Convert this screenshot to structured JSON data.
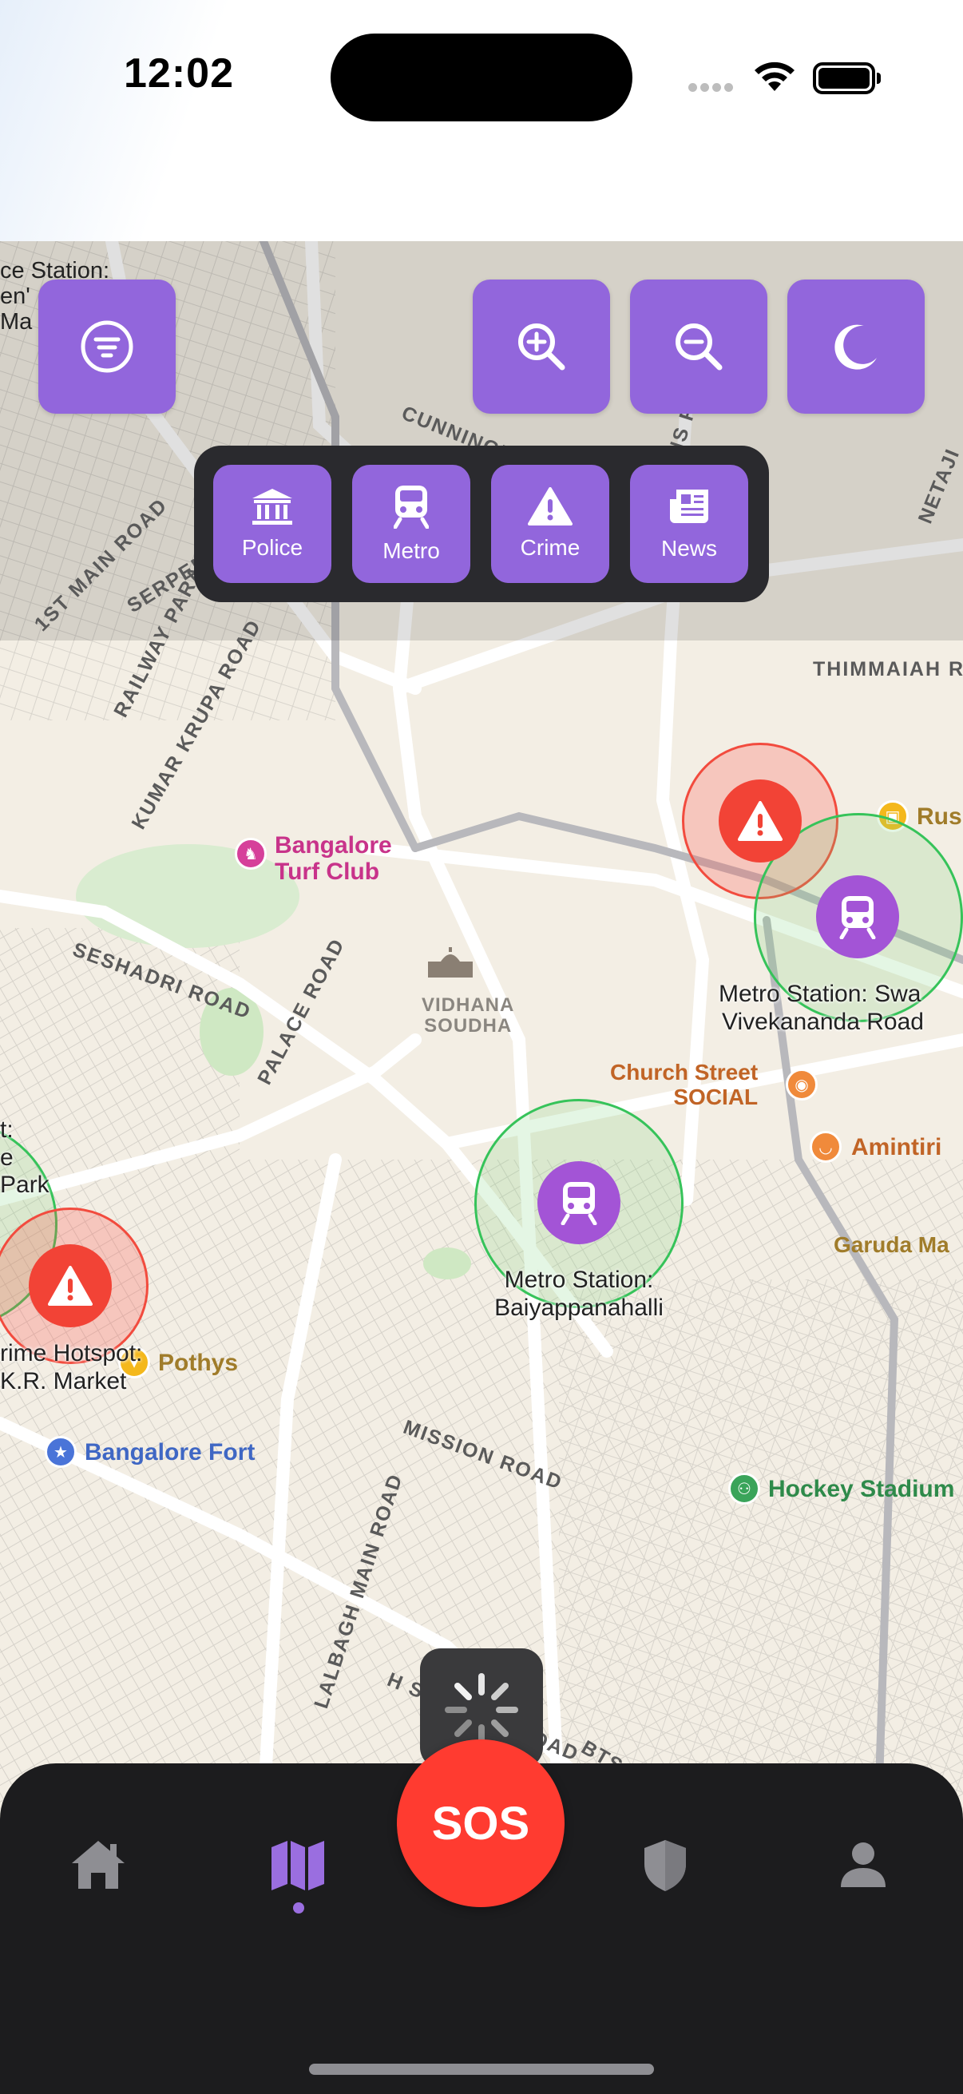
{
  "status_bar": {
    "time": "12:02"
  },
  "controls": {
    "filter_icon": "filter-icon",
    "zoom_in_icon": "zoom-in-icon",
    "zoom_out_icon": "zoom-out-icon",
    "theme_icon": "moon-icon"
  },
  "layers": [
    {
      "label": "Police",
      "icon": "bank-icon"
    },
    {
      "label": "Metro",
      "icon": "train-icon"
    },
    {
      "label": "Crime",
      "icon": "warning-icon"
    },
    {
      "label": "News",
      "icon": "newspaper-icon"
    }
  ],
  "map": {
    "roads": {
      "cunningham": "CUNNINGHAM ROAD",
      "queens": "QUEENS ROAD",
      "kumar_krupa": "KUMAR KRUPA ROAD",
      "seshadri": "SESHADRI ROAD",
      "palace": "PALACE ROAD",
      "mission": "MISSION ROAD",
      "lalbagh": "LALBAGH MAIN ROAD",
      "first_main": "1ST MAIN ROAD",
      "railway": "RAILWAY PARALLEL",
      "serpentine": "SERPENTINE",
      "thimmaiah": "THIMMAIAH RO",
      "netaji": "NETAJI",
      "siddaiah": "H SIDDAIAH ROAD",
      "bts": "BTS M"
    },
    "pois": {
      "turf_club_1": "Bangalore",
      "turf_club_2": "Turf Club",
      "vidhana_1": "VIDHANA",
      "vidhana_2": "SOUDHA",
      "church_1": "Church Street",
      "church_2": "SOCIAL",
      "amintiri": "Amintiri",
      "garuda": "Garuda Ma",
      "pothys": "Pothys",
      "fort": "Bangalore Fort",
      "hockey": "Hockey Stadium",
      "rus": "Rus",
      "left_station_1": "ce Station:",
      "left_station_2": "en'",
      "left_station_3": "Ma"
    },
    "overlays": {
      "metro_swami_1": "Metro Station: Swa",
      "metro_swami_2": "Vivekananda Road",
      "metro_baiyap_1": "Metro Station:",
      "metro_baiyap_2": "Baiyappanahalli",
      "crime_kr_1": "rime Hotspot:",
      "crime_kr_2": "K.R. Market",
      "left_park_1": "t:",
      "left_park_2": "e",
      "left_park_3": "Park"
    }
  },
  "tabbar": {
    "sos": "SOS",
    "tabs": [
      "home-icon",
      "map-icon",
      "shield-icon",
      "person-icon"
    ],
    "active": "map"
  },
  "colors": {
    "accent": "#9266dc",
    "sos": "#ff3b30",
    "crime": "#f24336",
    "metro": "#a354d6",
    "tabbar": "#1c1c1e"
  }
}
